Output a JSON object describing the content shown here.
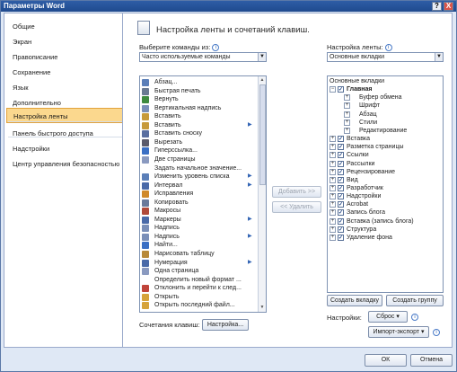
{
  "window": {
    "title": "Параметры Word",
    "help": "?",
    "close": "X"
  },
  "sidebar": {
    "items": [
      {
        "label": "Общие"
      },
      {
        "label": "Экран"
      },
      {
        "label": "Правописание"
      },
      {
        "label": "Сохранение"
      },
      {
        "label": "Язык"
      },
      {
        "label": "Дополнительно"
      },
      {
        "label": "Настройка ленты"
      },
      {
        "label": "Панель быстрого доступа"
      },
      {
        "label": "Надстройки"
      },
      {
        "label": "Центр управления безопасностью"
      }
    ],
    "selected": "Настройка ленты"
  },
  "header": {
    "title": "Настройка ленты и сочетаний клавиш."
  },
  "left": {
    "label": "Выберите команды из:",
    "combo": "Часто используемые команды",
    "commands": [
      {
        "label": "Абзац...",
        "icon": "paragraph-icon",
        "arrow": false
      },
      {
        "label": "Быстрая печать",
        "icon": "print-icon",
        "arrow": false
      },
      {
        "label": "Вернуть",
        "icon": "redo-icon",
        "arrow": false
      },
      {
        "label": "Вертикальная надпись",
        "icon": "textbox-icon",
        "arrow": false
      },
      {
        "label": "Вставить",
        "icon": "paste-icon",
        "arrow": false
      },
      {
        "label": "Вставить",
        "icon": "paste-icon",
        "arrow": true
      },
      {
        "label": "Вставить сноску",
        "icon": "footnote-icon",
        "arrow": false
      },
      {
        "label": "Вырезать",
        "icon": "cut-icon",
        "arrow": false
      },
      {
        "label": "Гиперссылка...",
        "icon": "hyperlink-icon",
        "arrow": false
      },
      {
        "label": "Две страницы",
        "icon": "two-pages-icon",
        "arrow": false
      },
      {
        "label": "Задать начальное значение...",
        "icon": "blank-icon",
        "arrow": false
      },
      {
        "label": "Изменить уровень списка",
        "icon": "list-level-icon",
        "arrow": true
      },
      {
        "label": "Интервал",
        "icon": "spacing-icon",
        "arrow": true
      },
      {
        "label": "Исправления",
        "icon": "track-changes-icon",
        "arrow": false
      },
      {
        "label": "Копировать",
        "icon": "copy-icon",
        "arrow": false
      },
      {
        "label": "Макросы",
        "icon": "macros-icon",
        "arrow": false
      },
      {
        "label": "Маркеры",
        "icon": "bullets-icon",
        "arrow": true
      },
      {
        "label": "Надпись",
        "icon": "textbox-icon",
        "arrow": false
      },
      {
        "label": "Надпись",
        "icon": "textbox-icon",
        "arrow": true
      },
      {
        "label": "Найти...",
        "icon": "find-icon",
        "arrow": false
      },
      {
        "label": "Нарисовать таблицу",
        "icon": "draw-table-icon",
        "arrow": false
      },
      {
        "label": "Нумерация",
        "icon": "numbering-icon",
        "arrow": true
      },
      {
        "label": "Одна страница",
        "icon": "one-page-icon",
        "arrow": false
      },
      {
        "label": "Определить новый формат ...",
        "icon": "blank-icon",
        "arrow": false
      },
      {
        "label": "Отклонить и перейти к след...",
        "icon": "reject-icon",
        "arrow": false
      },
      {
        "label": "Открыть",
        "icon": "open-icon",
        "arrow": false
      },
      {
        "label": "Открыть последний файл...",
        "icon": "open-recent-icon",
        "arrow": false
      }
    ],
    "shortcuts_label": "Сочетания клавиш:",
    "shortcuts_button": "Настройка..."
  },
  "middle": {
    "add": "Добавить >>",
    "remove": "<< Удалить"
  },
  "right": {
    "label": "Настройка ленты:",
    "combo": "Основные вкладки",
    "tree": [
      {
        "label": "Основные вкладки",
        "level": 0,
        "exp": "",
        "check": false
      },
      {
        "label": "Главная",
        "level": 1,
        "exp": "−",
        "check": true
      },
      {
        "label": "Буфер обмена",
        "level": 2,
        "exp": "+",
        "check": false
      },
      {
        "label": "Шрифт",
        "level": 2,
        "exp": "+",
        "check": false
      },
      {
        "label": "Абзац",
        "level": 2,
        "exp": "+",
        "check": false
      },
      {
        "label": "Стили",
        "level": 2,
        "exp": "+",
        "check": false
      },
      {
        "label": "Редактирование",
        "level": 2,
        "exp": "+",
        "check": false
      },
      {
        "label": "Вставка",
        "level": 1,
        "exp": "+",
        "check": true
      },
      {
        "label": "Разметка страницы",
        "level": 1,
        "exp": "+",
        "check": true
      },
      {
        "label": "Ссылки",
        "level": 1,
        "exp": "+",
        "check": true
      },
      {
        "label": "Рассылки",
        "level": 1,
        "exp": "+",
        "check": true
      },
      {
        "label": "Рецензирование",
        "level": 1,
        "exp": "+",
        "check": true
      },
      {
        "label": "Вид",
        "level": 1,
        "exp": "+",
        "check": true
      },
      {
        "label": "Разработчик",
        "level": 1,
        "exp": "+",
        "check": true
      },
      {
        "label": "Надстройки",
        "level": 1,
        "exp": "+",
        "check": true
      },
      {
        "label": "Acrobat",
        "level": 1,
        "exp": "+",
        "check": true
      },
      {
        "label": "Запись блога",
        "level": 1,
        "exp": "+",
        "check": true
      },
      {
        "label": "Вставка (запись блога)",
        "level": 1,
        "exp": "+",
        "check": true
      },
      {
        "label": "Структура",
        "level": 1,
        "exp": "+",
        "check": true
      },
      {
        "label": "Удаление фона",
        "level": 1,
        "exp": "+",
        "check": true
      }
    ],
    "new_tab": "Создать вкладку",
    "new_group": "Создать группу",
    "settings_label": "Настройки:",
    "reset": "Сброс",
    "import_export": "Импорт-экспорт"
  },
  "footer": {
    "ok": "ОК",
    "cancel": "Отмена"
  }
}
